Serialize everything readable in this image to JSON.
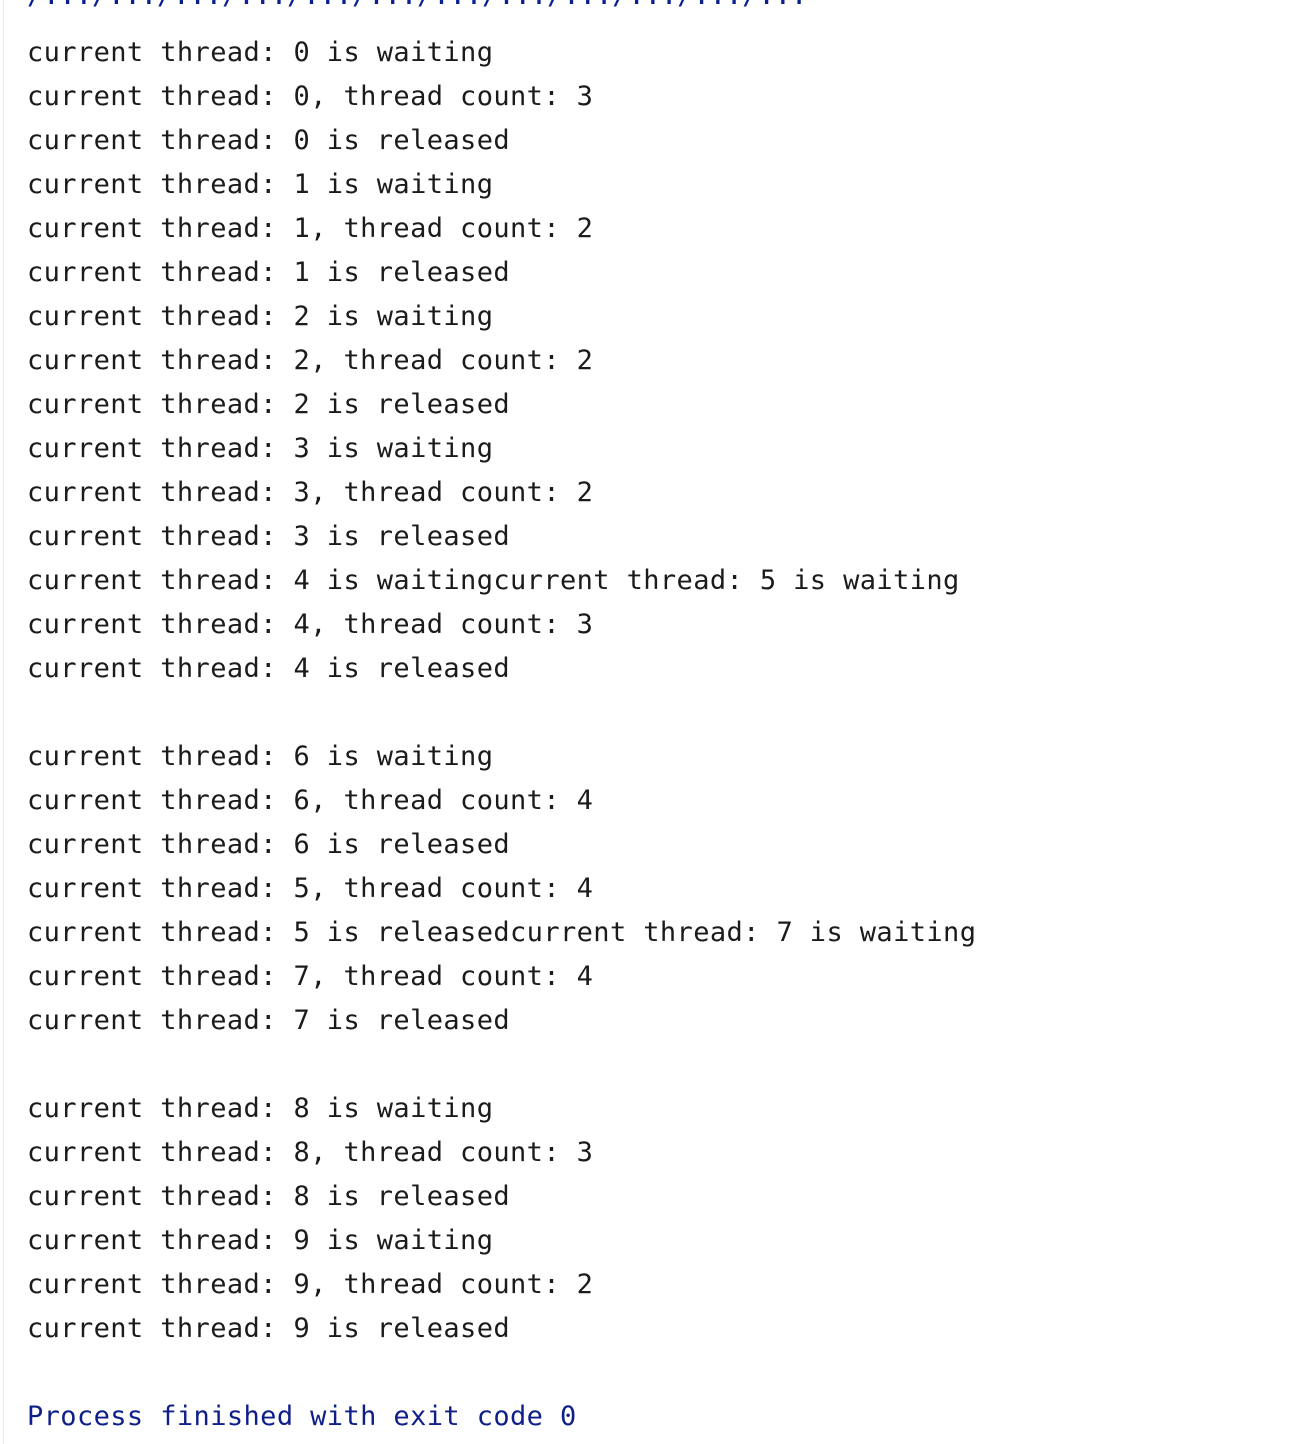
{
  "console": {
    "top_partial": "/.../.../.../.../.../.../.../.../.../.../.../...",
    "lines": [
      "current thread: 0 is waiting",
      "current thread: 0, thread count: 3",
      "current thread: 0 is released",
      "current thread: 1 is waiting",
      "current thread: 1, thread count: 2",
      "current thread: 1 is released",
      "current thread: 2 is waiting",
      "current thread: 2, thread count: 2",
      "current thread: 2 is released",
      "current thread: 3 is waiting",
      "current thread: 3, thread count: 2",
      "current thread: 3 is released",
      "current thread: 4 is waitingcurrent thread: 5 is waiting",
      "current thread: 4, thread count: 3",
      "current thread: 4 is released",
      "",
      "current thread: 6 is waiting",
      "current thread: 6, thread count: 4",
      "current thread: 6 is released",
      "current thread: 5, thread count: 4",
      "current thread: 5 is releasedcurrent thread: 7 is waiting",
      "current thread: 7, thread count: 4",
      "current thread: 7 is released",
      "",
      "current thread: 8 is waiting",
      "current thread: 8, thread count: 3",
      "current thread: 8 is released",
      "current thread: 9 is waiting",
      "current thread: 9, thread count: 2",
      "current thread: 9 is released",
      "",
      "Process finished with exit code 0"
    ]
  },
  "colors": {
    "text": "#1b1b1b",
    "exit_text": "#0f1f8a",
    "background": "#ffffff"
  }
}
